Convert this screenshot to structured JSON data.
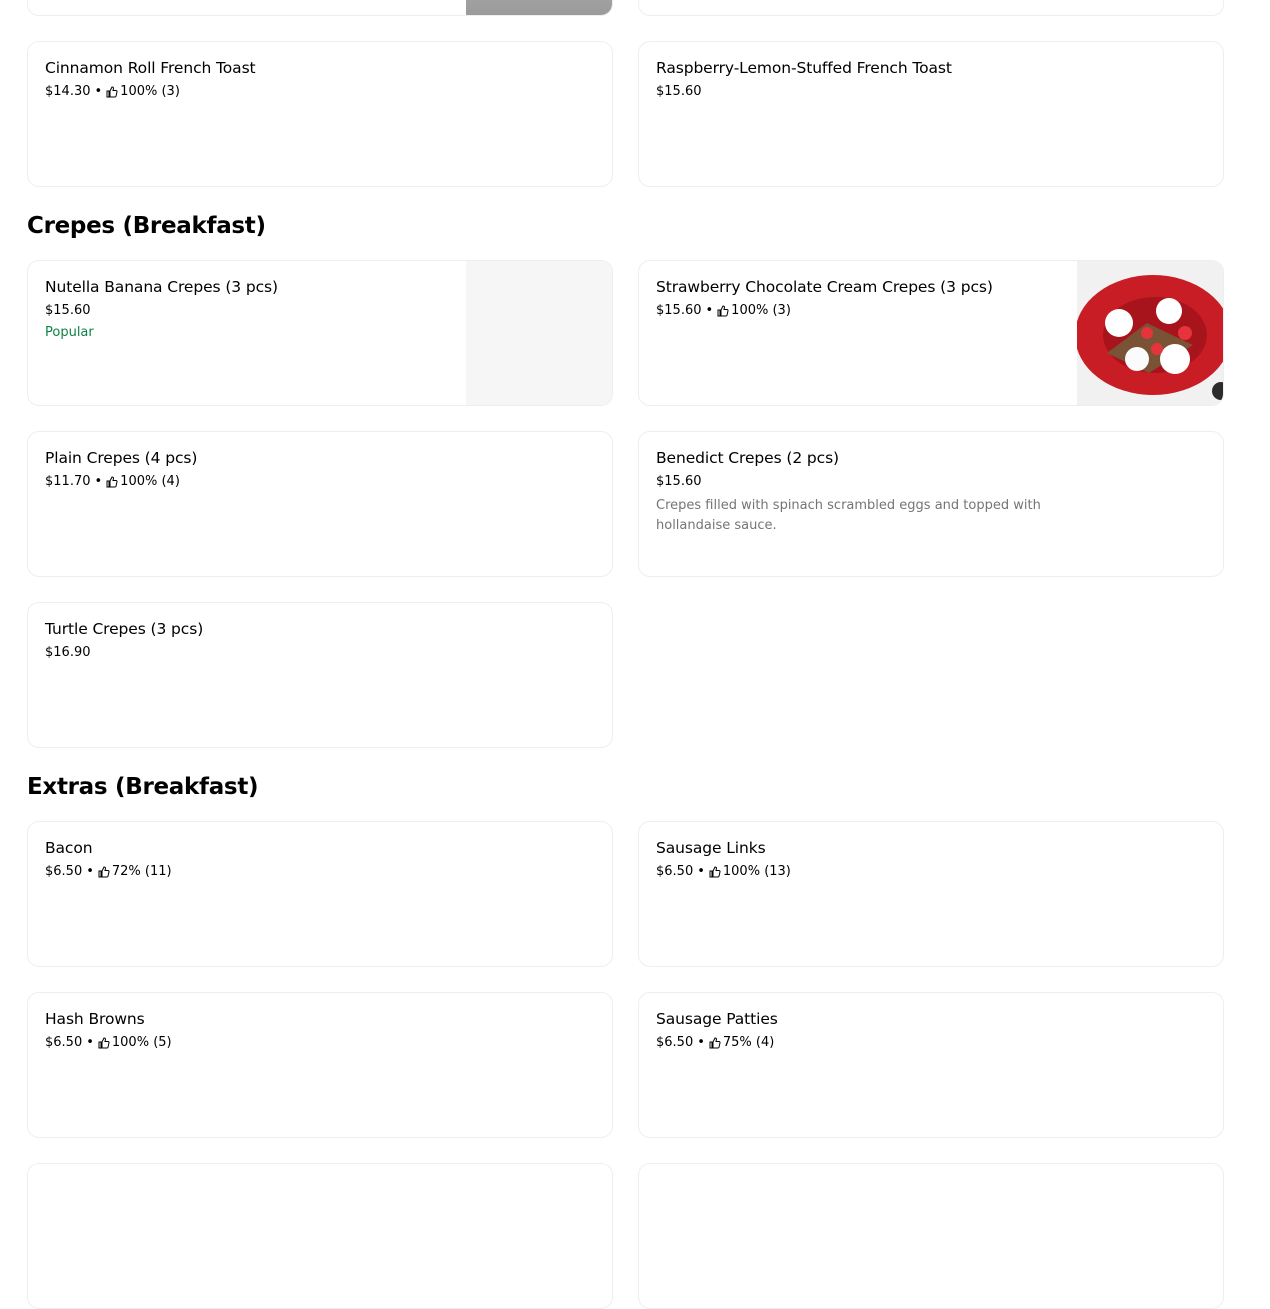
{
  "sections": {
    "crepes": {
      "title": "Crepes (Breakfast)"
    },
    "extras": {
      "title": "Extras (Breakfast)"
    }
  },
  "items": {
    "cinnamon": {
      "name": "Cinnamon Roll French Toast",
      "price": "$14.30",
      "rating": "100% (3)"
    },
    "raspberry": {
      "name": "Raspberry-Lemon-Stuffed French Toast",
      "price": "$15.60"
    },
    "nutella": {
      "name": "Nutella Banana Crepes (3 pcs)",
      "price": "$15.60",
      "badge": "Popular"
    },
    "strawberry": {
      "name": "Strawberry Chocolate Cream Crepes (3 pcs)",
      "price": "$15.60",
      "rating": "100% (3)"
    },
    "plain": {
      "name": "Plain Crepes (4 pcs)",
      "price": "$11.70",
      "rating": "100% (4)"
    },
    "benedict": {
      "name": "Benedict Crepes (2 pcs)",
      "price": "$15.60",
      "description": "Crepes filled with spinach scrambled eggs and topped with hollandaise sauce."
    },
    "turtle": {
      "name": "Turtle Crepes (3 pcs)",
      "price": "$16.90"
    },
    "bacon": {
      "name": "Bacon",
      "price": "$6.50",
      "rating": "72% (11)"
    },
    "sausage_links": {
      "name": "Sausage Links",
      "price": "$6.50",
      "rating": "100% (13)"
    },
    "hash_browns": {
      "name": "Hash Browns",
      "price": "$6.50",
      "rating": "100% (5)"
    },
    "sausage_patties": {
      "name": "Sausage Patties",
      "price": "$6.50",
      "rating": "75% (4)"
    }
  },
  "separator": "•",
  "icons": {
    "rating": "thumbs-up-icon"
  },
  "colors": {
    "popular": "#0e8345",
    "description": "#757575",
    "border": "#eeeeee"
  }
}
